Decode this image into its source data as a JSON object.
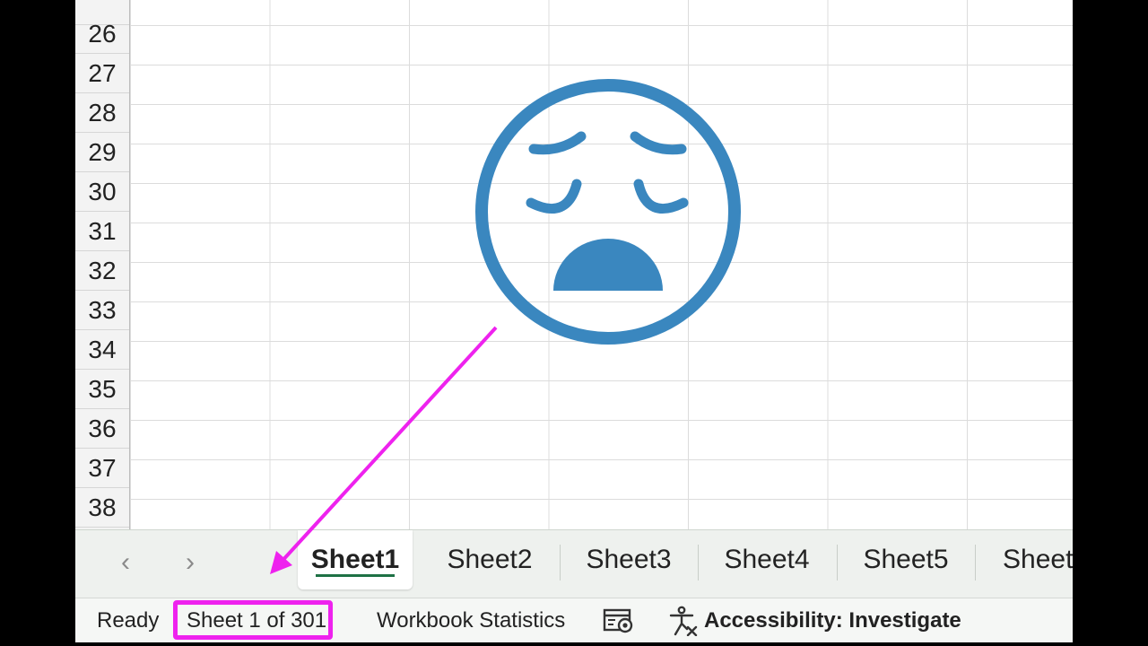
{
  "row_headers": [
    "26",
    "27",
    "28",
    "29",
    "30",
    "31",
    "32",
    "33",
    "34",
    "35",
    "36",
    "37",
    "38"
  ],
  "sheet_nav": {
    "prev_icon": "chevron-left-icon",
    "next_icon": "chevron-right-icon",
    "prev_glyph": "‹",
    "next_glyph": "›"
  },
  "sheet_tabs": [
    "Sheet1",
    "Sheet2",
    "Sheet3",
    "Sheet4",
    "Sheet5",
    "Sheet"
  ],
  "active_tab": "Sheet1",
  "status": {
    "ready": "Ready",
    "sheet_counter": "Sheet 1 of 301",
    "workbook_statistics": "Workbook Statistics",
    "accessibility": "Accessibility: Investigate"
  },
  "colors": {
    "accent_green": "#1e7145",
    "highlight_magenta": "#ee22ee",
    "face_blue": "#3a87bf"
  },
  "icons": [
    "sad-face-icon",
    "workbook-statistics-icon",
    "accessibility-icon"
  ]
}
